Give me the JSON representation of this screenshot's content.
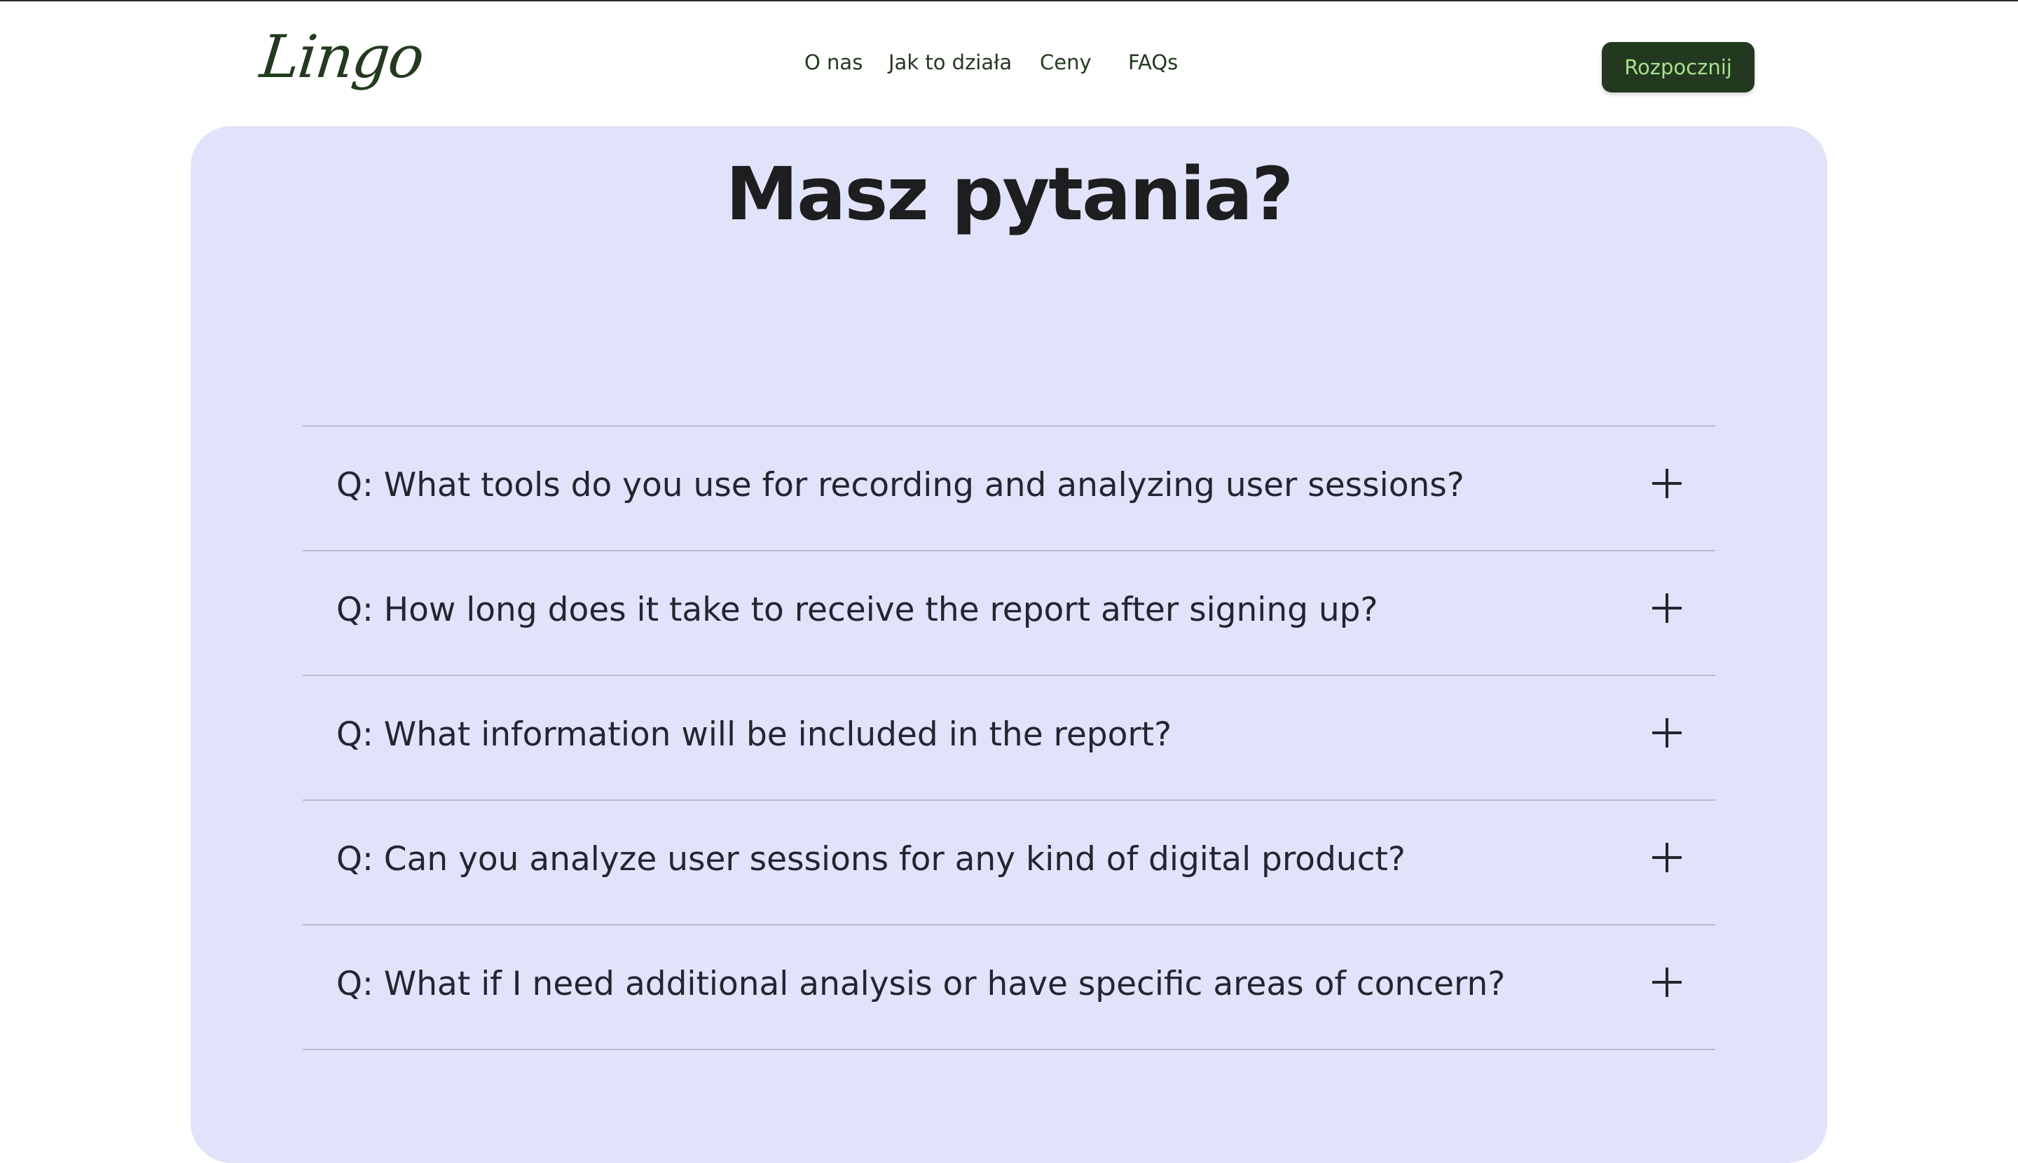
{
  "header": {
    "logo": "Lingo",
    "nav": [
      "O nas",
      "Jak to działa",
      "Ceny",
      "FAQs"
    ],
    "cta_label": "Rozpocznij"
  },
  "faq": {
    "title": "Masz pytania?",
    "items": [
      "Q: What tools do you use for recording and analyzing user sessions?",
      "Q: How long does it take to receive the report after signing up?",
      "Q: What information will be included in the report?",
      "Q: Can you analyze user sessions for any kind of digital product?",
      "Q: What if I need additional analysis or have specific areas of concern?"
    ]
  },
  "icons": {
    "expand": "plus-icon"
  },
  "colors": {
    "brand_dark": "#23391f",
    "cta_text": "#a8e08d",
    "panel_bg": "#e1e3fa",
    "text": "#232530"
  }
}
